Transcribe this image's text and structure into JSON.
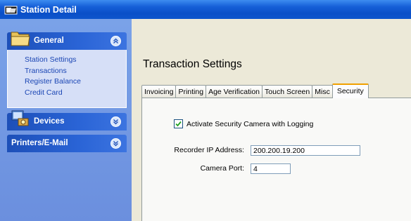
{
  "window": {
    "title": "Station Detail"
  },
  "sidebar": {
    "groups": [
      {
        "label": "General",
        "items": [
          {
            "label": "Station Settings"
          },
          {
            "label": "Transactions"
          },
          {
            "label": "Register Balance"
          },
          {
            "label": "Credit Card"
          }
        ]
      },
      {
        "label": "Devices"
      },
      {
        "label": "Printers/E-Mail"
      }
    ]
  },
  "main": {
    "title": "Transaction Settings",
    "tabs": [
      {
        "label": "Invoicing"
      },
      {
        "label": "Printing"
      },
      {
        "label": "Age Verification"
      },
      {
        "label": "Touch Screen"
      },
      {
        "label": "Misc"
      },
      {
        "label": "Security"
      }
    ],
    "active_tab": "Security",
    "security": {
      "camera_checkbox": {
        "label": "Activate Security Camera with Logging",
        "checked": true
      },
      "recorder_ip": {
        "label": "Recorder IP Address:",
        "value": "200.200.19.200"
      },
      "camera_port": {
        "label": "Camera Port:",
        "value": "4"
      }
    }
  },
  "colors": {
    "titlebar": "#0a4fc8",
    "taskpane": "#6b8fde",
    "group_header": "#2a64d6",
    "link": "#1b46b4",
    "active_tab_accent": "#f0a000"
  },
  "icons": {
    "window": "folder-window-icon",
    "general": "folder-icon",
    "devices": "devices-icon",
    "collapse": "chevron-up-icon",
    "expand": "chevron-down-icon"
  }
}
